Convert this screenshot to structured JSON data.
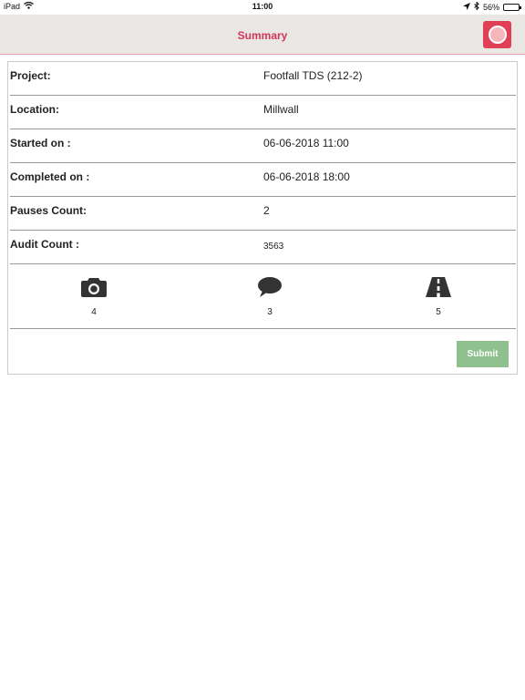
{
  "status_bar": {
    "device": "iPad",
    "time": "11:00",
    "battery": "56%",
    "battery_level": 0.56
  },
  "header": {
    "title": "Summary"
  },
  "summary": {
    "rows": [
      {
        "label": "Project:",
        "value": "Footfall TDS (212-2)"
      },
      {
        "label": "Location:",
        "value": "Millwall"
      },
      {
        "label": "Started on :",
        "value": "06-06-2018 11:00"
      },
      {
        "label": "Completed on :",
        "value": "06-06-2018 18:00"
      },
      {
        "label": "Pauses Count:",
        "value": "2"
      },
      {
        "label": "Audit Count :",
        "value": "3563"
      }
    ]
  },
  "counters": {
    "photos": {
      "icon": "camera-icon",
      "count": "4"
    },
    "comments": {
      "icon": "speech-bubble-icon",
      "count": "3"
    },
    "road": {
      "icon": "road-icon",
      "count": "5"
    }
  },
  "actions": {
    "submit_label": "Submit"
  },
  "colors": {
    "title": "#d2365a",
    "nav_background": "#e8e7e3",
    "submit": "#8fc18f",
    "logo": "#e03f55"
  }
}
